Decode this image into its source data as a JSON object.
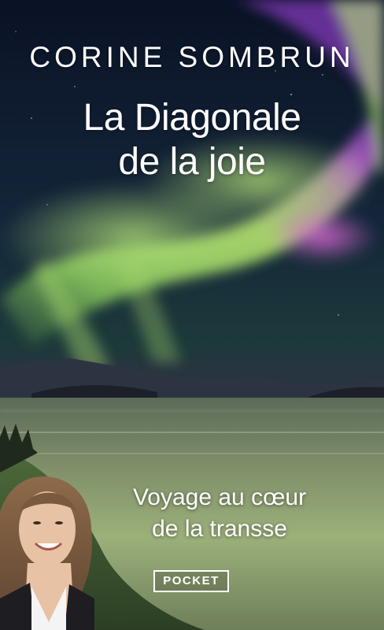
{
  "author": "CORINE SOMBRUN",
  "title_lines": [
    "La Diagonale",
    "de la joie"
  ],
  "subtitle_lines": [
    "Voyage au cœur",
    "de la transse"
  ],
  "publisher": "POCKET",
  "colors": {
    "sky_top": "#0b1326",
    "aurora_green": "#9fdc6a",
    "aurora_magenta": "#d24fd0",
    "text": "#ffffff"
  }
}
